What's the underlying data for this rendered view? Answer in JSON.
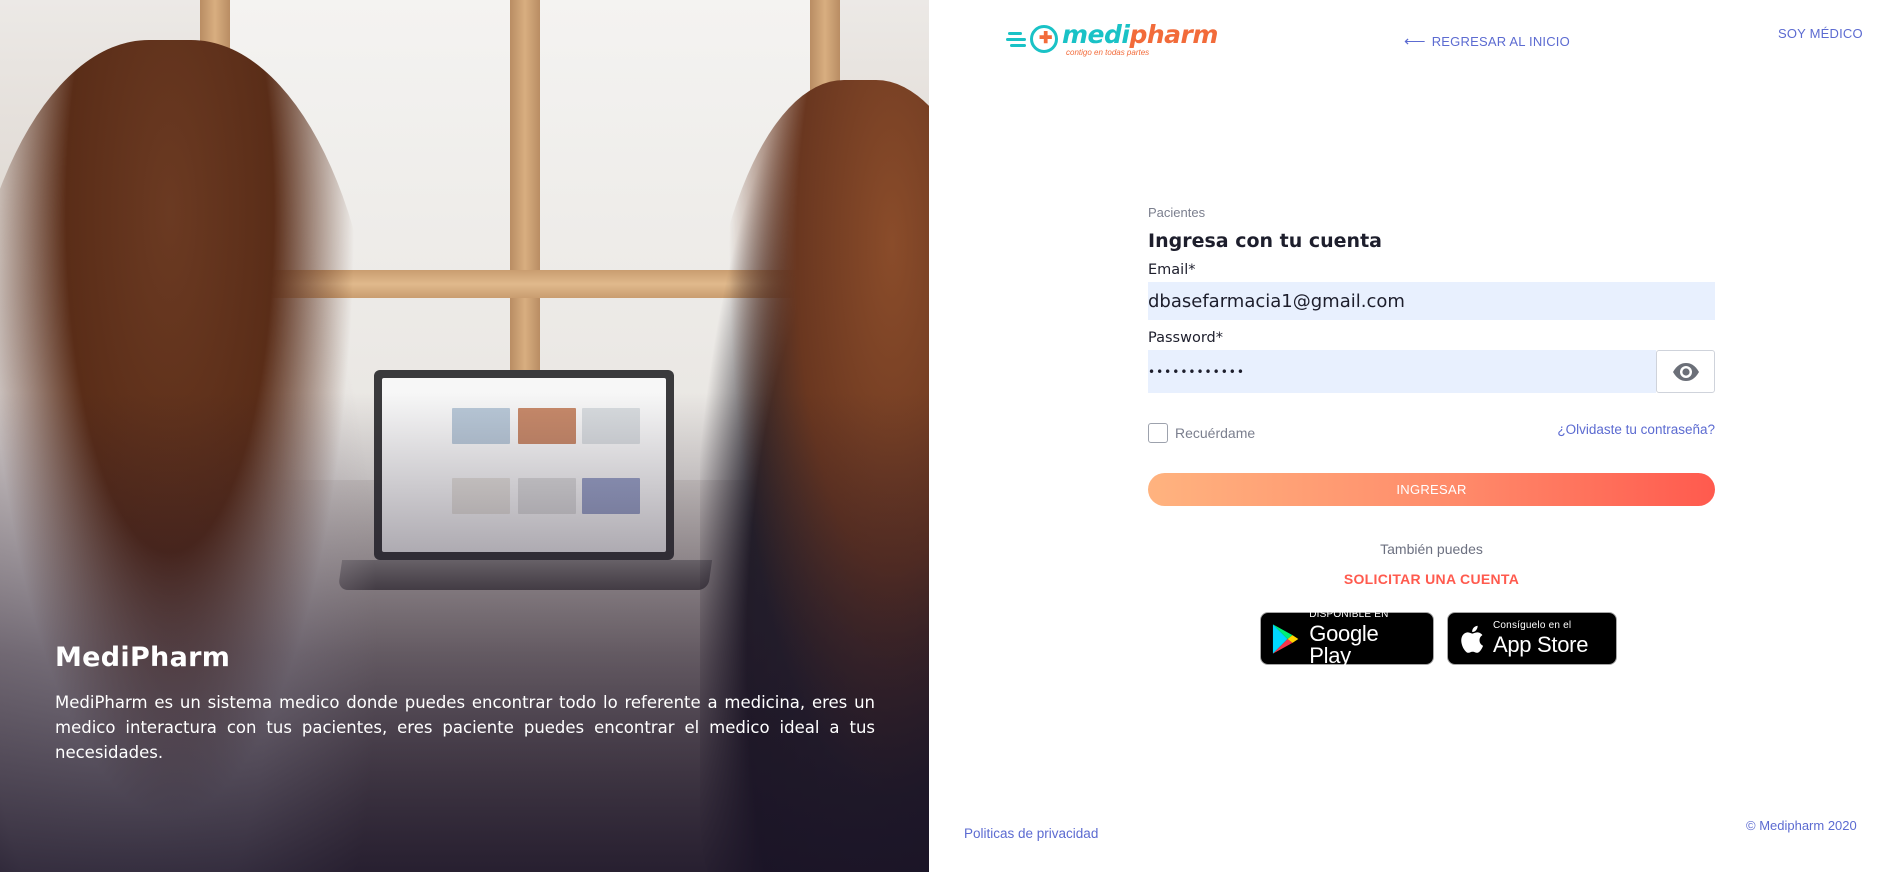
{
  "hero": {
    "title": "MediPharm",
    "description": "MediPharm es un sistema medico donde puedes encontrar todo lo referente a medicina, eres un medico interactura con tus pacientes, eres paciente puedes encontrar el medico ideal a tus necesidades."
  },
  "brand": {
    "name_part1": "medi",
    "name_part2": "pharm",
    "tagline": "contigo en todas partes",
    "primary_color": "#19c2c6",
    "accent_color": "#f26b3a"
  },
  "nav": {
    "back_label": "REGRESAR AL INICIO",
    "doctor_label": "SOY MÉDICO"
  },
  "form": {
    "eyebrow": "Pacientes",
    "heading": "Ingresa con tu cuenta",
    "email_label": "Email*",
    "email_value": "dbasefarmacia1@gmail.com",
    "password_label": "Password*",
    "password_value": "••••••••••••",
    "remember_label": "Recuérdame",
    "remember_checked": false,
    "forgot_label": "¿Olvidaste tu contraseña?",
    "submit_label": "INGRESAR",
    "also_label": "También puedes",
    "request_label": "SOLICITAR UNA CUENTA"
  },
  "stores": {
    "google_small": "DISPONIBLE EN",
    "google_big": "Google Play",
    "apple_small": "Consíguelo en el",
    "apple_big": "App Store"
  },
  "footer": {
    "privacy": "Politicas de privacidad",
    "copyright": "© Medipharm 2020"
  },
  "colors": {
    "link": "#5c6bd1",
    "button_gradient_start": "#ffb37f",
    "button_gradient_end": "#ff5a4e",
    "input_bg": "#e8f0fe"
  }
}
